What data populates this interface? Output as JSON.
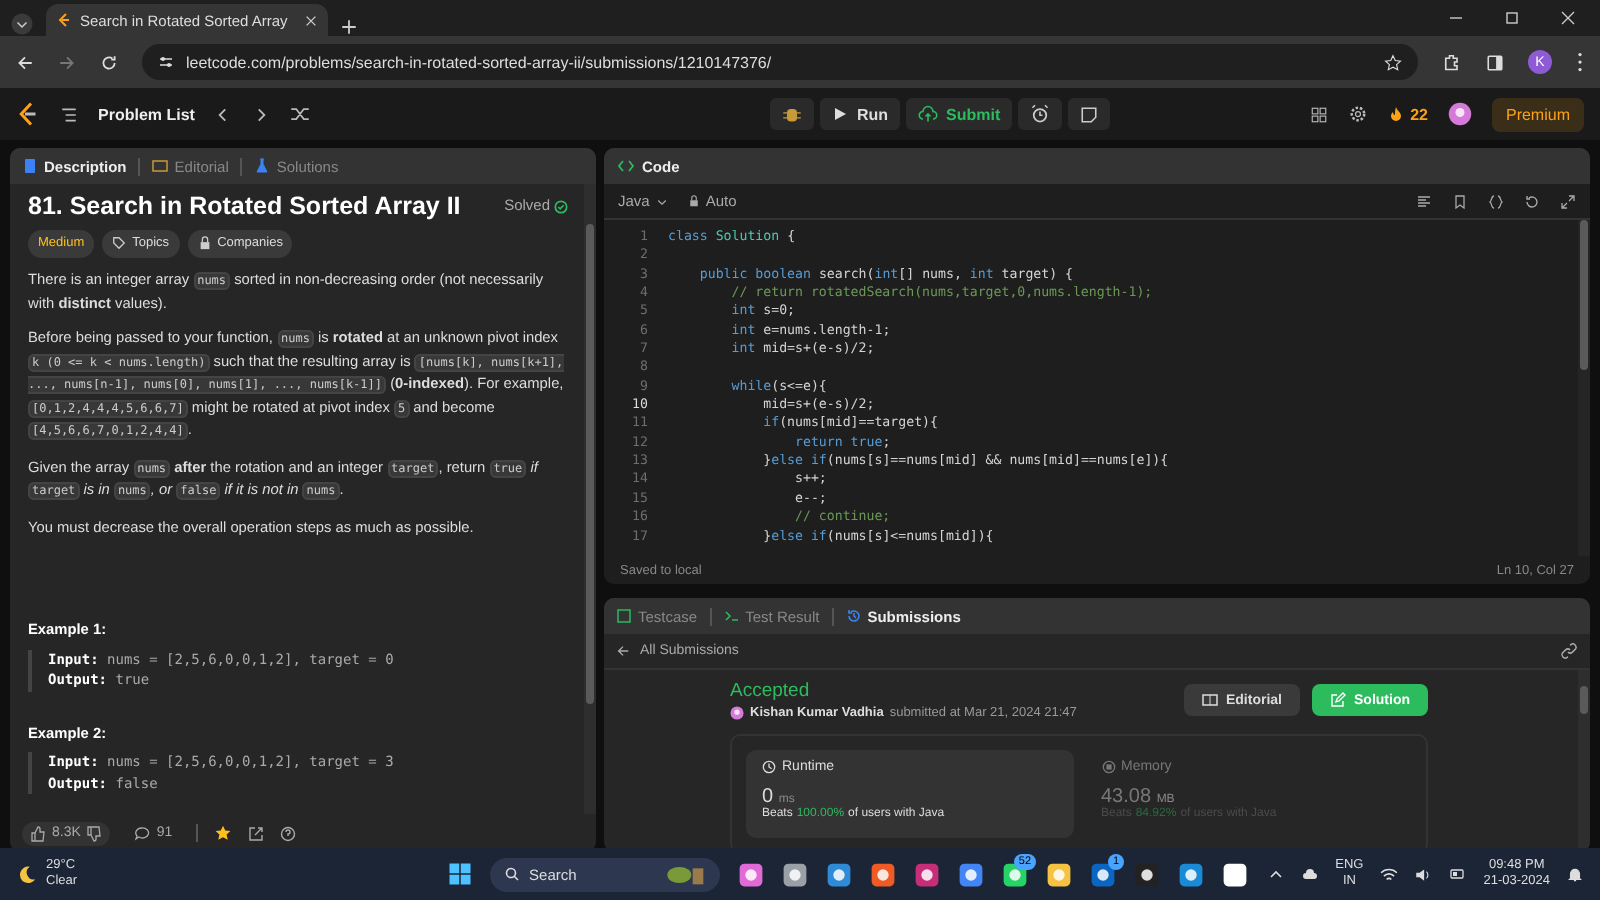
{
  "browser": {
    "tab_title": "Search in Rotated Sorted Array",
    "url": "leetcode.com/problems/search-in-rotated-sorted-array-ii/submissions/1210147376/",
    "avatar": "K"
  },
  "nav": {
    "problem_list": "Problem List",
    "run": "Run",
    "submit": "Submit",
    "streak": "22",
    "premium": "Premium"
  },
  "description": {
    "tabs": [
      {
        "label": "Description",
        "selected": true
      },
      {
        "label": "Editorial",
        "selected": false
      },
      {
        "label": "Solutions",
        "selected": false
      }
    ],
    "title": "81. Search in Rotated Sorted Array II",
    "status": "Solved",
    "tags": [
      {
        "kind": "difficulty",
        "label": "Medium"
      },
      {
        "kind": "topics",
        "label": "Topics"
      },
      {
        "kind": "companies",
        "label": "Companies"
      }
    ],
    "paragraphs": [
      [
        {
          "kind": "text",
          "text": "There is an integer array "
        },
        {
          "kind": "code",
          "text": "nums"
        },
        {
          "kind": "text",
          "text": " sorted in non-decreasing order (not necessarily with "
        },
        {
          "kind": "bold",
          "text": "distinct"
        },
        {
          "kind": "text",
          "text": " values)."
        }
      ],
      [
        {
          "kind": "text",
          "text": "Before being passed to your function, "
        },
        {
          "kind": "code",
          "text": "nums"
        },
        {
          "kind": "text",
          "text": " is "
        },
        {
          "kind": "bold",
          "text": "rotated"
        },
        {
          "kind": "text",
          "text": " at an unknown pivot index "
        },
        {
          "kind": "code",
          "text": "k (0 <= k < nums.length)"
        },
        {
          "kind": "text",
          "text": " such that the resulting array is "
        },
        {
          "kind": "code",
          "text": "[nums[k], nums[k+1], ..., nums[n-1], nums[0], nums[1], ..., nums[k-1]]"
        },
        {
          "kind": "text",
          "text": " ("
        },
        {
          "kind": "bold",
          "text": "0-indexed"
        },
        {
          "kind": "text",
          "text": "). For example, "
        },
        {
          "kind": "code",
          "text": "[0,1,2,4,4,4,5,6,6,7]"
        },
        {
          "kind": "text",
          "text": " might be rotated at pivot index "
        },
        {
          "kind": "code",
          "text": "5"
        },
        {
          "kind": "text",
          "text": " and become "
        },
        {
          "kind": "code",
          "text": "[4,5,6,6,7,0,1,2,4,4]"
        },
        {
          "kind": "text",
          "text": "."
        }
      ],
      [
        {
          "kind": "text",
          "text": "Given the array "
        },
        {
          "kind": "code",
          "text": "nums"
        },
        {
          "kind": "bold",
          "text": " after"
        },
        {
          "kind": "text",
          "text": " the rotation and an integer "
        },
        {
          "kind": "code",
          "text": "target"
        },
        {
          "kind": "text",
          "text": ", return "
        },
        {
          "kind": "code",
          "text": "true"
        },
        {
          "kind": "italic",
          "text": " if "
        },
        {
          "kind": "code",
          "text": "target"
        },
        {
          "kind": "italic",
          "text": " is in "
        },
        {
          "kind": "code",
          "text": "nums"
        },
        {
          "kind": "italic",
          "text": ", or "
        },
        {
          "kind": "code",
          "text": "false"
        },
        {
          "kind": "italic",
          "text": " if it is not in "
        },
        {
          "kind": "code",
          "text": "nums"
        },
        {
          "kind": "text",
          "text": "."
        }
      ],
      [
        {
          "kind": "text",
          "text": "You must decrease the overall operation steps as much as possible."
        }
      ]
    ],
    "examples": [
      {
        "title": "Example 1:",
        "input_label": "Input:",
        "input": "nums = [2,5,6,0,0,1,2], target = 0",
        "output_label": "Output:",
        "output": "true"
      },
      {
        "title": "Example 2:",
        "input_label": "Input:",
        "input": "nums = [2,5,6,0,0,1,2], target = 3",
        "output_label": "Output:",
        "output": "false"
      }
    ],
    "likes": "8.3K",
    "comments": "91"
  },
  "editor": {
    "title": "Code",
    "language": "Java",
    "mode": "Auto",
    "status": "Saved to local",
    "cursor": "Ln 10, Col 27",
    "lines": [
      {
        "number": "1",
        "current": false,
        "tokens": [
          {
            "kind": "kw",
            "text": "class"
          },
          {
            "kind": "type",
            "text": " Solution"
          },
          {
            "kind": "plain",
            "text": " {"
          }
        ]
      },
      {
        "number": "2",
        "current": false
      },
      {
        "number": "3",
        "current": false,
        "tokens": [
          {
            "kind": "kw",
            "text": "    public boolean"
          },
          {
            "kind": "plain",
            "text": " search("
          },
          {
            "kind": "kw",
            "text": "int"
          },
          {
            "kind": "plain",
            "text": "[] nums, "
          },
          {
            "kind": "kw",
            "text": "int"
          },
          {
            "kind": "plain",
            "text": " target) {"
          }
        ]
      },
      {
        "number": "4",
        "current": false,
        "tokens": [
          {
            "kind": "comment",
            "text": "        // return rotatedSearch(nums,target,0,nums.length-1);"
          }
        ]
      },
      {
        "number": "5",
        "current": false,
        "tokens": [
          {
            "kind": "kw",
            "text": "        int"
          },
          {
            "kind": "plain",
            "text": " s=0;"
          }
        ]
      },
      {
        "number": "6",
        "current": false,
        "tokens": [
          {
            "kind": "kw",
            "text": "        int"
          },
          {
            "kind": "plain",
            "text": " e=nums.length-1;"
          }
        ]
      },
      {
        "number": "7",
        "current": false,
        "tokens": [
          {
            "kind": "kw",
            "text": "        int"
          },
          {
            "kind": "plain",
            "text": " mid=s+(e-s)/2;"
          }
        ]
      },
      {
        "number": "8",
        "current": false
      },
      {
        "number": "9",
        "current": false,
        "tokens": [
          {
            "kind": "kw",
            "text": "        while"
          },
          {
            "kind": "plain",
            "text": "(s<=e){"
          }
        ]
      },
      {
        "number": "10",
        "current": true,
        "tokens": [
          {
            "kind": "plain",
            "text": "            mid=s+(e-s)/2;"
          }
        ]
      },
      {
        "number": "11",
        "current": false,
        "tokens": [
          {
            "kind": "kw",
            "text": "            if"
          },
          {
            "kind": "plain",
            "text": "(nums[mid]==target){"
          }
        ]
      },
      {
        "number": "12",
        "current": false,
        "tokens": [
          {
            "kind": "kw",
            "text": "                return true"
          },
          {
            "kind": "plain",
            "text": ";"
          }
        ]
      },
      {
        "number": "13",
        "current": false,
        "tokens": [
          {
            "kind": "plain",
            "text": "            }"
          },
          {
            "kind": "kw",
            "text": "else if"
          },
          {
            "kind": "plain",
            "text": "(nums[s]==nums[mid] && nums[mid]==nums[e]){"
          }
        ]
      },
      {
        "number": "14",
        "current": false,
        "tokens": [
          {
            "kind": "plain",
            "text": "                s++;"
          }
        ]
      },
      {
        "number": "15",
        "current": false,
        "tokens": [
          {
            "kind": "plain",
            "text": "                e--;"
          }
        ]
      },
      {
        "number": "16",
        "current": false,
        "tokens": [
          {
            "kind": "comment",
            "text": "                // continue;"
          }
        ]
      },
      {
        "number": "17",
        "current": false,
        "tokens": [
          {
            "kind": "plain",
            "text": "            }"
          },
          {
            "kind": "kw",
            "text": "else if"
          },
          {
            "kind": "plain",
            "text": "(nums[s]<=nums[mid]){"
          }
        ]
      }
    ]
  },
  "results": {
    "tabs": [
      {
        "label": "Testcase",
        "selected": false
      },
      {
        "label": "Test Result",
        "selected": false
      },
      {
        "label": "Submissions",
        "selected": true
      }
    ],
    "back": "All Submissions",
    "status": "Accepted",
    "author": "Kishan Kumar Vadhia",
    "submitted": "submitted at Mar 21, 2024 21:47",
    "buttons": [
      {
        "kind": "editorial",
        "label": "Editorial"
      },
      {
        "kind": "solution",
        "label": "Solution"
      }
    ],
    "stats": [
      {
        "kind": "runtime",
        "label": "Runtime",
        "value": "0",
        "unit": "ms",
        "beats": "Beats",
        "percent": "100.00%",
        "suffix": "of users with Java",
        "selected": true
      },
      {
        "kind": "memory",
        "label": "Memory",
        "value": "43.08",
        "unit": "MB",
        "beats": "Beats",
        "percent": "84.92%",
        "suffix": "of users with Java",
        "selected": false
      }
    ]
  },
  "taskbar": {
    "temperature": "29°C",
    "weather": "Clear",
    "search": "Search",
    "apps": [
      {
        "kind": "copilot"
      },
      {
        "kind": "taskview"
      },
      {
        "kind": "vscode"
      },
      {
        "kind": "brave"
      },
      {
        "kind": "intellij"
      },
      {
        "kind": "chrome"
      },
      {
        "kind": "whatsapp",
        "badge": "52"
      },
      {
        "kind": "folder"
      },
      {
        "kind": "linkedin",
        "badge": "1"
      },
      {
        "kind": "terminal"
      },
      {
        "kind": "bing"
      },
      {
        "kind": "circle"
      }
    ],
    "language": "ENG",
    "region": "IN",
    "time": "09:48 PM",
    "date": "21-03-2024"
  }
}
